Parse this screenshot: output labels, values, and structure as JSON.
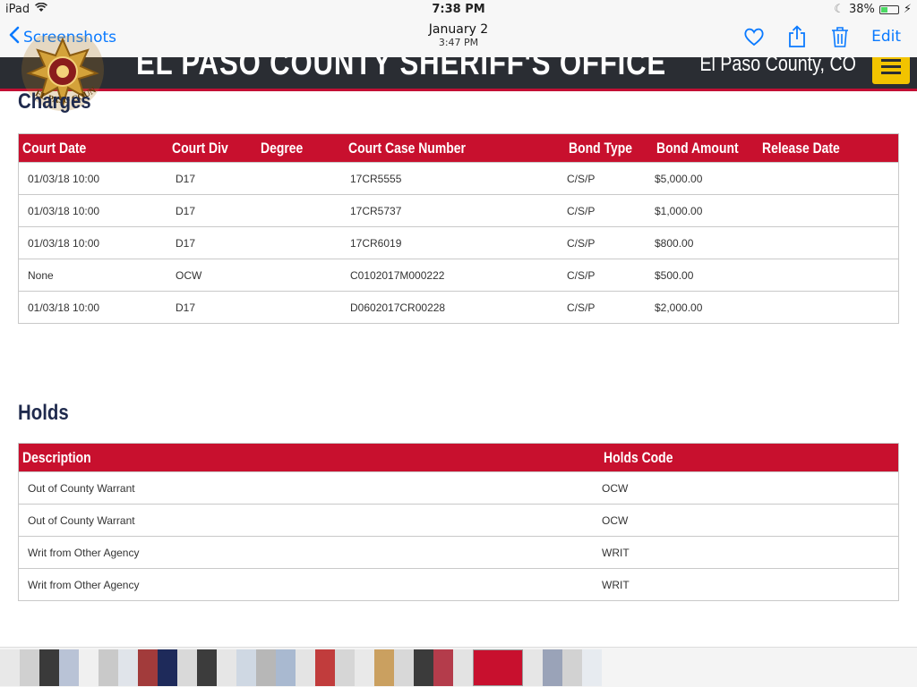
{
  "status_bar": {
    "device": "iPad",
    "time": "7:38 PM",
    "battery": "38%",
    "battery_level": 0.38
  },
  "photos_nav": {
    "back_label": "Screenshots",
    "date": "January 2",
    "time": "3:47 PM",
    "edit_label": "Edit",
    "accent_color": "#0a7aff"
  },
  "site_header": {
    "title": "EL PASO COUNTY SHERIFF'S OFFICE",
    "county": "El Paso County, CO",
    "logo_text": "EL PASO COUNTY",
    "brand_color": "#c8102e",
    "menu_color": "#f2c300"
  },
  "charges": {
    "heading": "Charges",
    "columns": [
      "Court Date",
      "Court Div",
      "Degree",
      "Court Case Number",
      "Bond Type",
      "Bond Amount",
      "Release Date"
    ],
    "rows": [
      [
        "01/03/18 10:00",
        "D17",
        "",
        "17CR5555",
        "C/S/P",
        "$5,000.00",
        ""
      ],
      [
        "01/03/18 10:00",
        "D17",
        "",
        "17CR5737",
        "C/S/P",
        "$1,000.00",
        ""
      ],
      [
        "01/03/18 10:00",
        "D17",
        "",
        "17CR6019",
        "C/S/P",
        "$800.00",
        ""
      ],
      [
        "None",
        "OCW",
        "",
        "C0102017M000222",
        "C/S/P",
        "$500.00",
        ""
      ],
      [
        "01/03/18 10:00",
        "D17",
        "",
        "D0602017CR00228",
        "C/S/P",
        "$2,000.00",
        ""
      ]
    ]
  },
  "holds": {
    "heading": "Holds",
    "columns": [
      "Description",
      "Holds Code"
    ],
    "rows": [
      [
        "Out of County Warrant",
        "OCW"
      ],
      [
        "Out of County Warrant",
        "OCW"
      ],
      [
        "Writ from Other Agency",
        "WRIT"
      ],
      [
        "Writ from Other Agency",
        "WRIT"
      ]
    ]
  },
  "thumbnail_strip": {
    "colors": [
      "#e8e8e8",
      "#d0d0d0",
      "#3a3a3a",
      "#b9c3d6",
      "#f0f0f0",
      "#c9c9c9",
      "#e0e4ea",
      "#a23b3b",
      "#1e2a5a",
      "#d9d9d9",
      "#3c3c3c",
      "#e6e6e6",
      "#cfd8e3",
      "#b7b7b7",
      "#a9b9d0",
      "#e4e4e4",
      "#c13c3c",
      "#d6d6d6",
      "#e9e9e9",
      "#caa060",
      "#d8d8d8",
      "#3b3b3b",
      "#b43c4b",
      "#e3e3e3",
      "#c8102e",
      "#e6e6e6",
      "#9aa3b8",
      "#d2d2d2",
      "#e7ebf0"
    ]
  }
}
